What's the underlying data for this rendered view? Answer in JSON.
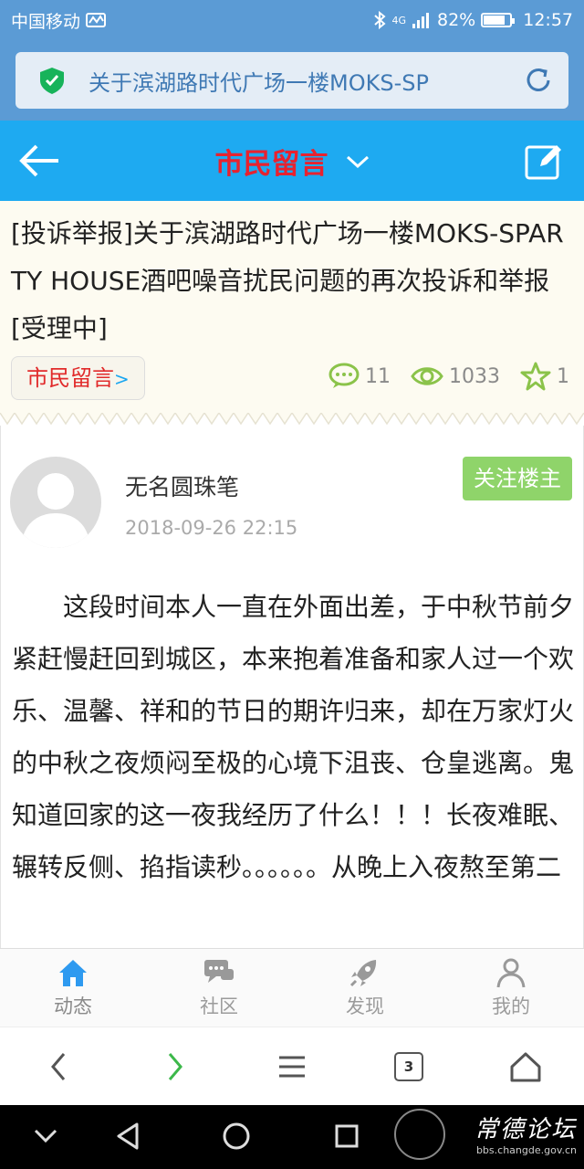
{
  "status_bar": {
    "carrier": "中国移动",
    "network": "4G",
    "battery": "82%",
    "battery_level": 0.82,
    "time": "12:57"
  },
  "url_bar": {
    "text": "关于滨湖路时代广场一楼MOKS-SP"
  },
  "app_bar": {
    "title": "市民留言"
  },
  "post_header": {
    "title": "[投诉举报]关于滨湖路时代广场一楼MOKS-SPARTY HOUSE酒吧噪音扰民问题的再次投诉和举报 [受理中]",
    "category": "市民留言",
    "category_arrow": ">",
    "comments": "11",
    "views": "1033",
    "favorites": "1"
  },
  "post": {
    "author": "无名圆珠笔",
    "time": "2018-09-26 22:15",
    "follow_label": "关注楼主",
    "content": "这段时间本人一直在外面出差，于中秋节前夕紧赶慢赶回到城区，本来抱着准备和家人过一个欢乐、温馨、祥和的节日的期许归来，却在万家灯火的中秋之夜烦闷至极的心境下沮丧、仓皇逃离。鬼知道回家的这一夜我经历了什么！！！长夜难眠、辗转反侧、掐指读秒。。。。。。从晚上入夜熬至第二"
  },
  "tab_bar": {
    "items": [
      {
        "label": "动态",
        "icon": "home-icon"
      },
      {
        "label": "社区",
        "icon": "chat-icon"
      },
      {
        "label": "发现",
        "icon": "rocket-icon"
      },
      {
        "label": "我的",
        "icon": "person-icon"
      }
    ]
  },
  "browser_bar": {
    "tab_count": "3"
  },
  "watermark": {
    "logo_text": "常德论坛",
    "url": "bbs.changde.gov.cn"
  },
  "colors": {
    "accent": "#1eaaf1",
    "title_red": "#e8222f",
    "follow_green": "#8fd46a",
    "active_tab": "#2e9af0",
    "status_blue": "#5b9bd5"
  }
}
